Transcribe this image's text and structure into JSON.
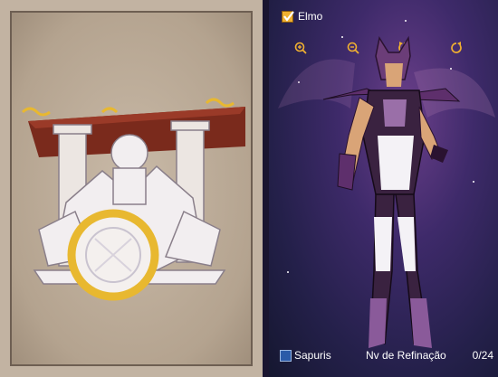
{
  "viewer": {
    "helmet_label": "Elmo",
    "helmet_checked": true,
    "controls": [
      {
        "name": "zoom-in-icon"
      },
      {
        "name": "zoom-out-icon"
      },
      {
        "name": "rotate-left-icon"
      },
      {
        "name": "rotate-right-icon"
      }
    ],
    "sapuris_label": "Sapuris",
    "sapuris_checked": false,
    "refine_label": "Nv de Refinação",
    "refine_value": "0/24"
  },
  "colors": {
    "accent": "#f0b030",
    "gold": "#e8b830",
    "checkbox_blue": "#2a5aa8"
  }
}
